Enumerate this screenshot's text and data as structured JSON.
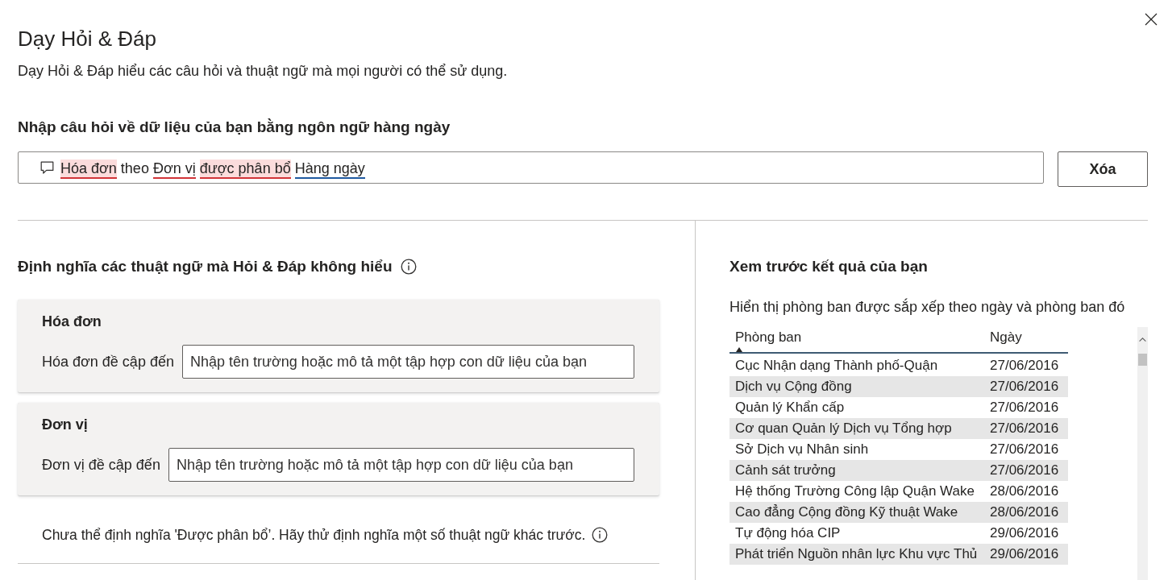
{
  "dialog": {
    "title": "Dạy Hỏi & Đáp",
    "subtitle": "Dạy Hỏi & Đáp hiểu các câu hỏi và thuật ngữ mà mọi người có thể sử dụng."
  },
  "question": {
    "heading": "Nhập câu hỏi về dữ liệu của bạn bằng ngôn ngữ hàng ngày",
    "tokens": [
      {
        "text": "Hóa đơn",
        "kind": "unknown",
        "highlighted": true
      },
      {
        "text": "theo",
        "kind": "plain",
        "highlighted": false
      },
      {
        "text": "Đơn vị",
        "kind": "unknown",
        "highlighted": false
      },
      {
        "text": "được phân bổ",
        "kind": "unknown",
        "highlighted": true
      },
      {
        "text": "Hàng ngày",
        "kind": "recognized",
        "highlighted": false
      }
    ],
    "clear_button": "Xóa"
  },
  "definitions": {
    "heading": "Định nghĩa các thuật ngữ mà Hỏi & Đáp không hiểu",
    "terms": [
      {
        "title": "Hóa đơn",
        "label": "Hóa đơn đề cập đến",
        "placeholder": "Nhập tên trường hoặc mô tả một tập hợp con dữ liệu của bạn"
      },
      {
        "title": "Đơn vị",
        "label": "Đơn vị đề cập đến",
        "placeholder": "Nhập tên trường hoặc mô tả một tập hợp con dữ liệu của bạn"
      }
    ],
    "note": "Chưa thể định nghĩa 'Được phân bổ’. Hãy thử định nghĩa một số thuật ngữ khác trước."
  },
  "preview": {
    "heading": "Xem trước kết quả của bạn",
    "description": "Hiển thị phòng ban được sắp xếp theo ngày và phòng ban đó",
    "table": {
      "columns": [
        {
          "label": "Phòng ban",
          "sorted": true
        },
        {
          "label": "Ngày",
          "sorted": false
        }
      ],
      "rows": [
        [
          "Cục Nhận dạng Thành phố-Quận",
          "27/06/2016"
        ],
        [
          "Dịch vụ Cộng đồng",
          "27/06/2016"
        ],
        [
          "Quản lý Khẩn cấp",
          "27/06/2016"
        ],
        [
          "Cơ quan Quản lý Dịch vụ Tổng hợp",
          "27/06/2016"
        ],
        [
          "Sở Dịch vụ Nhân sinh",
          "27/06/2016"
        ],
        [
          "Cảnh sát trưởng",
          "27/06/2016"
        ],
        [
          "Hệ thống Trường Công lập Quận Wake",
          "28/06/2016"
        ],
        [
          "Cao đẳng Cộng đồng Kỹ thuật Wake",
          "28/06/2016"
        ],
        [
          "Tự động hóa CIP",
          "29/06/2016"
        ],
        [
          "Phát triển Nguồn nhân lực Khu vực Thủ",
          "29/06/2016"
        ]
      ]
    }
  }
}
